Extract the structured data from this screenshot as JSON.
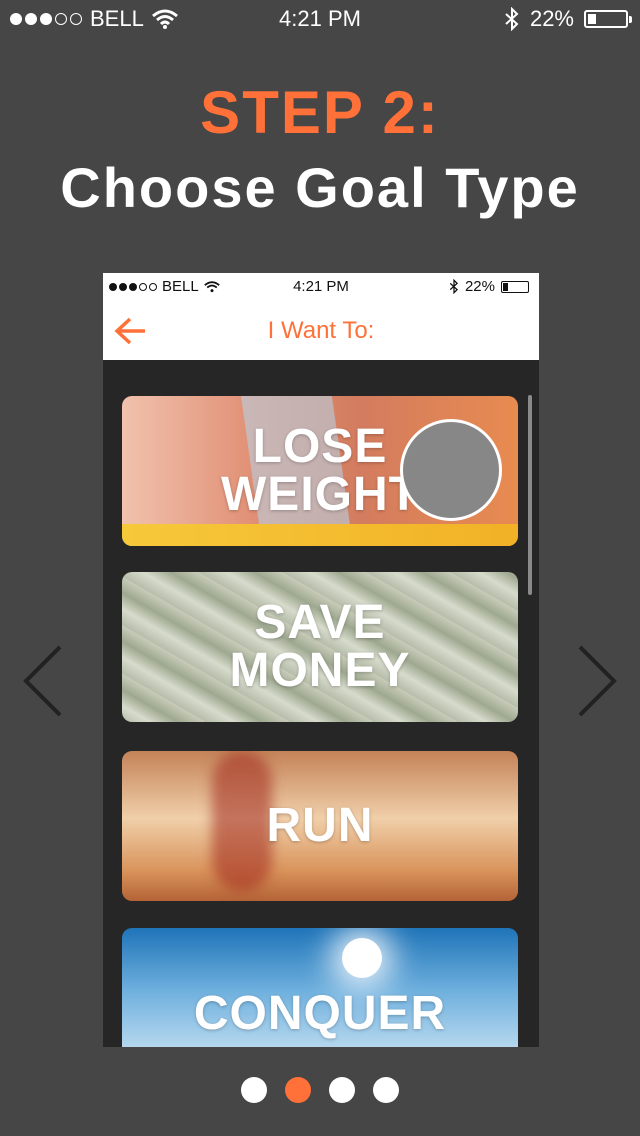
{
  "status_bar": {
    "carrier": "BELL",
    "time": "4:21 PM",
    "battery": "22%",
    "battery_level": 0.22,
    "signal_bars": 3,
    "signal_total": 5
  },
  "heading": {
    "step": "STEP 2:",
    "title": "Choose Goal Type"
  },
  "phone": {
    "status_bar": {
      "carrier": "BELL",
      "time": "4:21 PM",
      "battery": "22%"
    },
    "nav": {
      "title": "I Want To:",
      "back_icon": "back-arrow-icon"
    },
    "goals": [
      {
        "label": "LOSE\nWEIGHT"
      },
      {
        "label": "SAVE\nMONEY"
      },
      {
        "label": "RUN"
      },
      {
        "label": "CONQUER"
      }
    ]
  },
  "pager": {
    "count": 4,
    "active_index": 1
  },
  "colors": {
    "accent": "#ff7138",
    "background": "#464646",
    "phone_background": "#272626"
  }
}
